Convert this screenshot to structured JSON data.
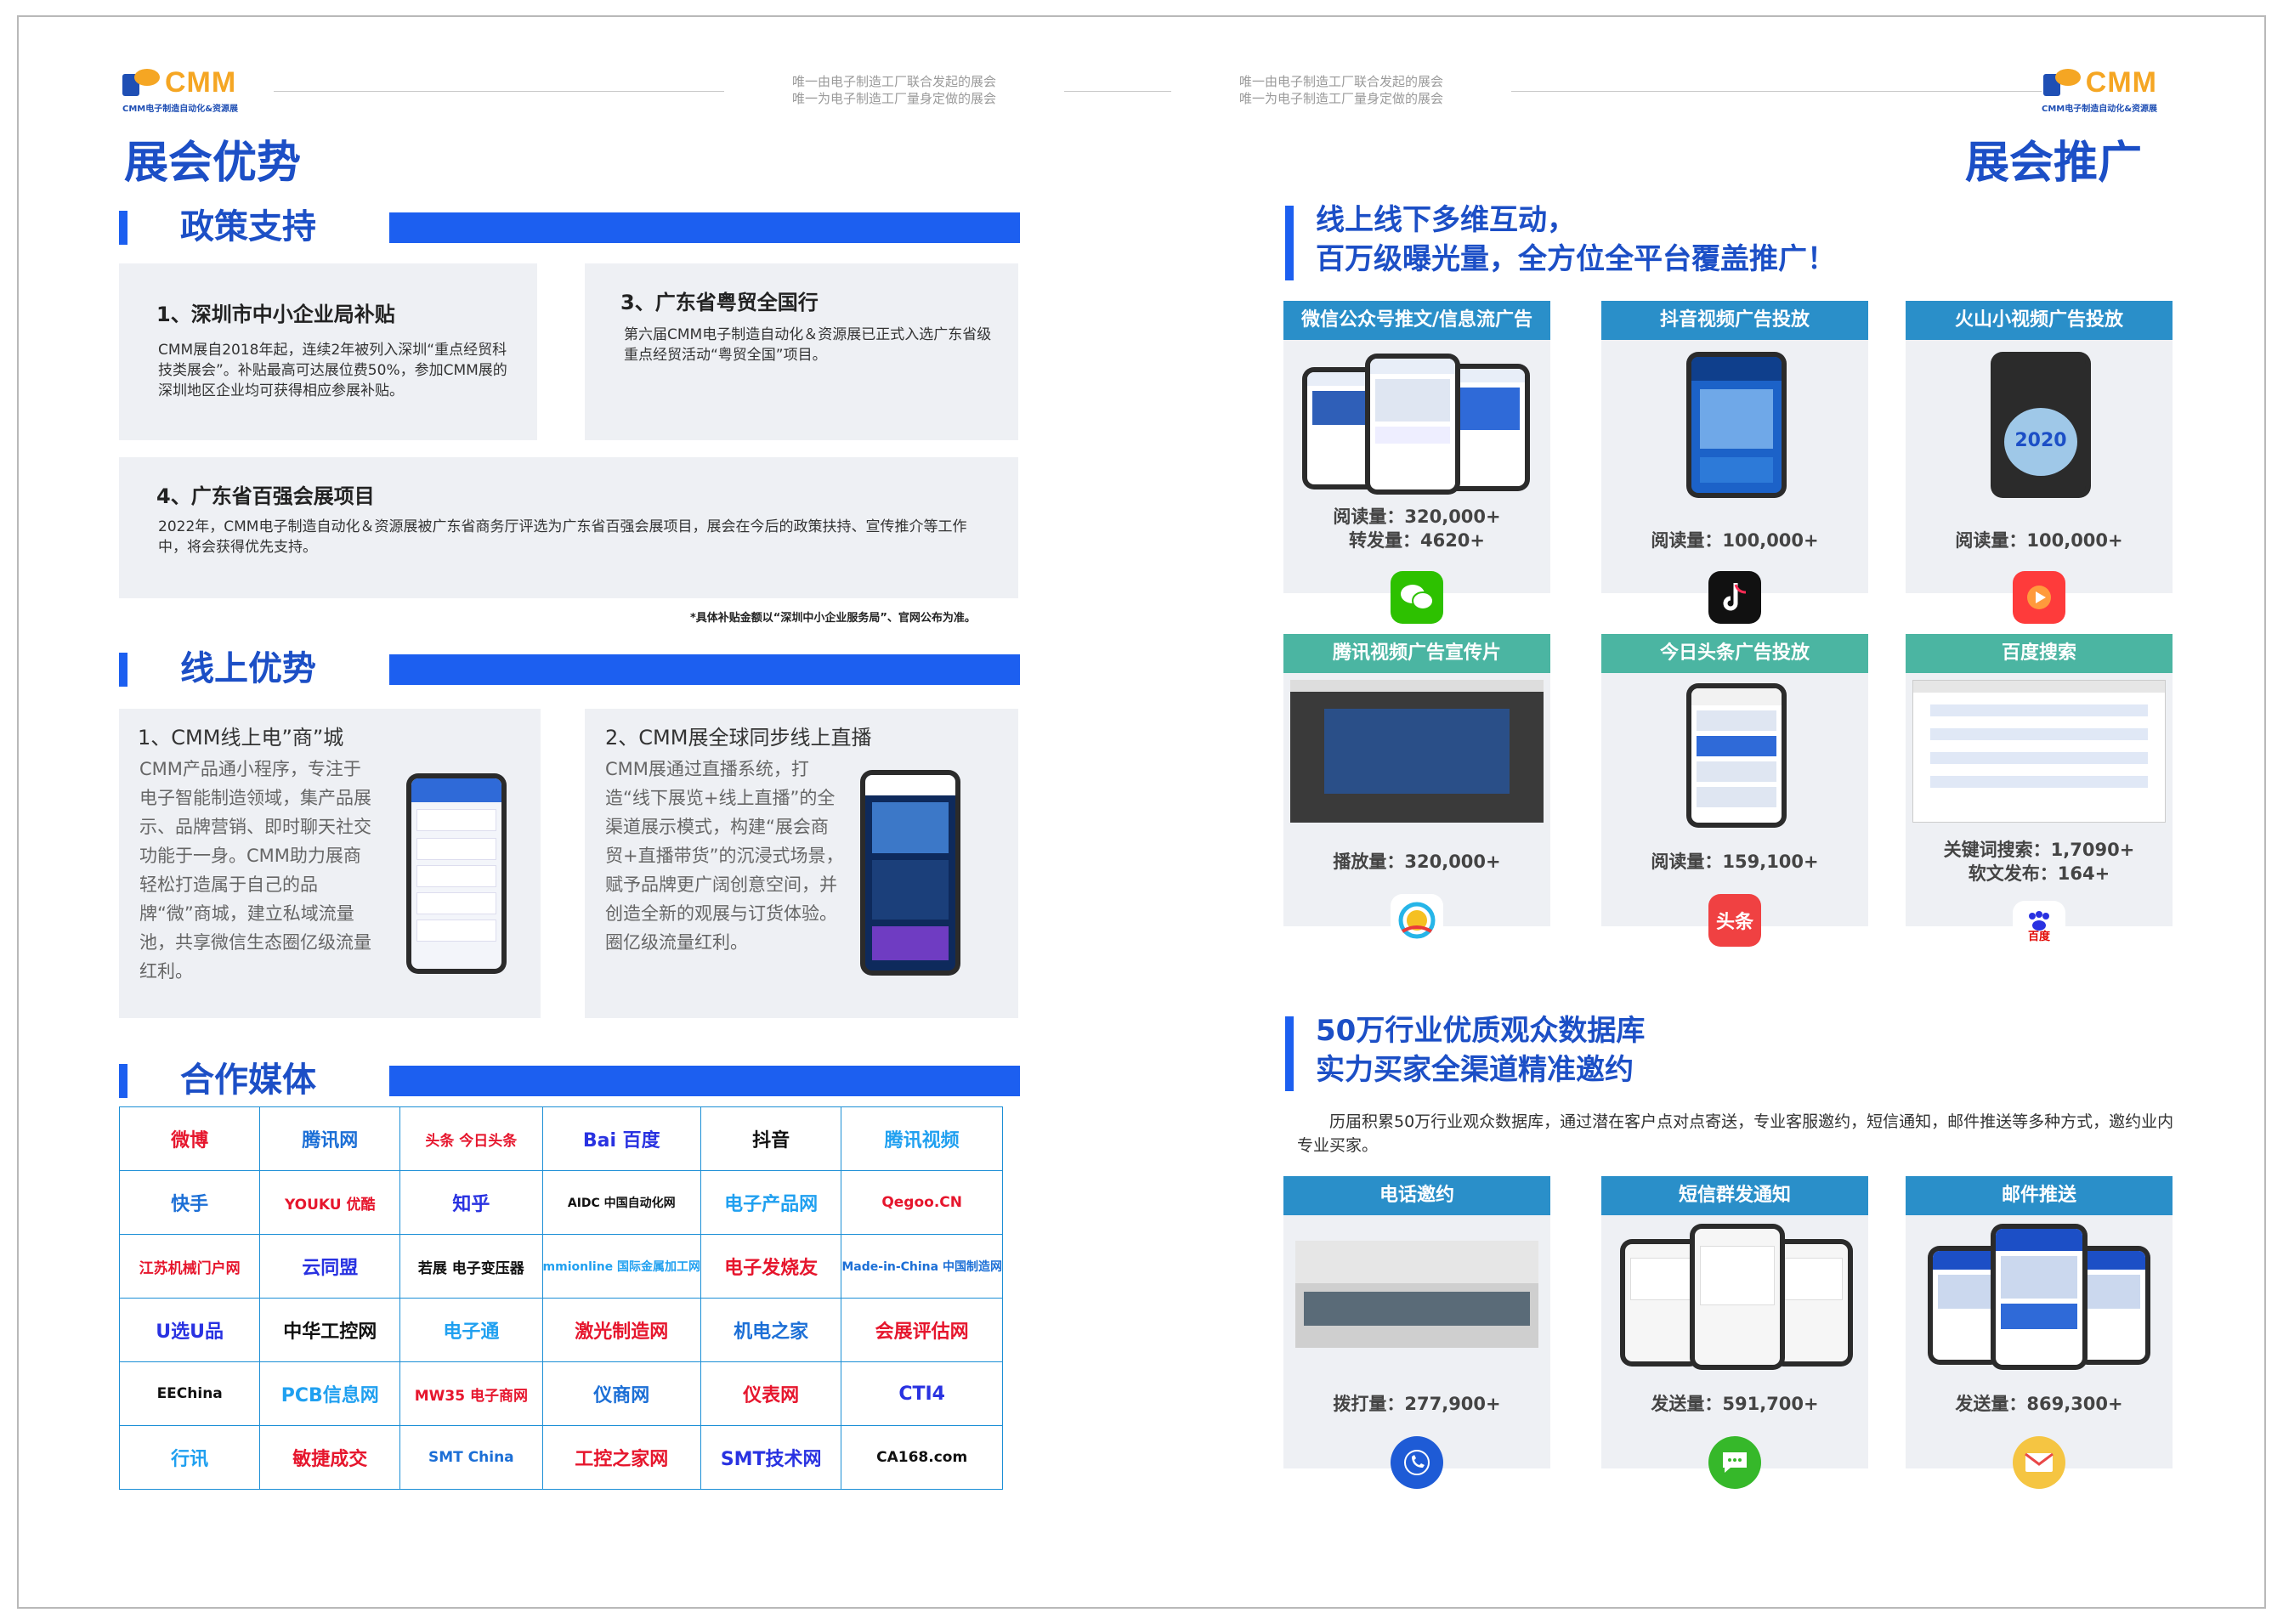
{
  "header": {
    "logo_text": "CMM",
    "logo_sub": "CMM电子制造自动化&资源展",
    "slogan_line1": "唯一由电子制造工厂联合发起的展会",
    "slogan_line2": "唯一为电子制造工厂量身定做的展会"
  },
  "left": {
    "title": "展会优势",
    "policy": {
      "heading": "政策支持",
      "card1_title": "1、深圳市中小企业局补贴",
      "card1_body": "CMM展自2018年起，连续2年被列入深圳“重点经贸科技类展会”。补贴最高可达展位费50%，参加CMM展的深圳地区企业均可获得相应参展补贴。",
      "card3_title": "3、广东省粤贸全国行",
      "card3_body": "第六届CMM电子制造自动化＆资源展已正式入选广东省级重点经贸活动“粤贸全国”项目。",
      "card4_title": "4、广东省百强会展项目",
      "card4_body": "2022年，CMM电子制造自动化＆资源展被广东省商务厅评选为广东省百强会展项目，展会在今后的政策扶持、宣传推介等工作中，将会获得优先支持。",
      "note": "*具体补贴金额以“深圳中小企业服务局”、官网公布为准。"
    },
    "online": {
      "heading": "线上优势",
      "item1_title": "1、CMM线上电”商”城",
      "item1_body": "CMM产品通小程序，专注于电子智能制造领域，集产品展示、品牌营销、即时聊天社交功能于一身。CMM助力展商轻松打造属于自己的品牌“微”商城，建立私域流量池，共享微信生态圈亿级流量红利。",
      "item2_title": "2、CMM展全球同步线上直播",
      "item2_body": "CMM展通过直播系统，打造“线下展览+线上直播”的全渠道展示模式，构建“展会商贸+直播带货”的沉浸式场景，赋予品牌更广阔创意空间，并创造全新的观展与订货体验。圈亿级流量红利。"
    },
    "media": {
      "heading": "合作媒体",
      "rows": [
        [
          "微博",
          "腾讯网",
          "头条 今日头条",
          "Bai 百度",
          "抖音",
          "腾讯视频"
        ],
        [
          "快手",
          "YOUKU 优酷",
          "知乎",
          "AIDC 中国自动化网",
          "电子产品网",
          "Qegoo.CN"
        ],
        [
          "江苏机械门户网",
          "云同盟",
          "若展 电子变压器",
          "mmionline 国际金属加工网",
          "电子发烧友",
          "Made-in-China 中国制造网"
        ],
        [
          "U选U品",
          "中华工控网",
          "电子通",
          "激光制造网",
          "机电之家",
          "会展评估网"
        ],
        [
          "EEChina",
          "PCB信息网",
          "MW35 电子商网",
          "仪商网",
          "仪表网",
          "CTI4"
        ],
        [
          "行讯",
          "敏捷成交",
          "SMT China",
          "工控之家网",
          "SMT技术网",
          "CA168.com"
        ]
      ]
    }
  },
  "right": {
    "title": "展会推广",
    "promo_heading_line1": "线上线下多维互动，",
    "promo_heading_line2": "百万级曝光量，全方位全平台覆盖推广！",
    "cards": [
      {
        "title": "微信公众号推文/信息流广告",
        "stat1": "阅读量：320,000+",
        "stat2": "转发量：4620+",
        "icon": "wechat-icon"
      },
      {
        "title": "抖音视频广告投放",
        "stat1": "阅读量：100,000+",
        "stat2": "",
        "icon": "tiktok-icon"
      },
      {
        "title": "火山小视频广告投放",
        "stat1": "阅读量：100,000+",
        "stat2": "",
        "icon": "huoshan-icon"
      },
      {
        "title": "腾讯视频广告宣传片",
        "stat1": "播放量：320,000+",
        "stat2": "",
        "icon": "tencent-video-icon"
      },
      {
        "title": "今日头条广告投放",
        "stat1": "阅读量：159,100+",
        "stat2": "",
        "icon": "toutiao-icon"
      },
      {
        "title": "百度搜索",
        "stat1": "关键词搜索：1,7090+",
        "stat2": "软文发布：164+",
        "icon": "baidu-icon"
      }
    ],
    "toutiao_icon_text": "头条",
    "baidu_icon_text": "百度",
    "screen_year": "2020",
    "db_heading_line1": "50万行业优质观众数据库",
    "db_heading_line2": "实力买家全渠道精准邀约",
    "db_desc": "历届积累50万行业观众数据库，通过潜在客户点对点寄送，专业客服邀约，短信通知，邮件推送等多种方式，邀约业内专业买家。",
    "invite_cards": [
      {
        "title": "电话邀约",
        "stat": "拨打量：277,900+",
        "icon": "phone-icon"
      },
      {
        "title": "短信群发通知",
        "stat": "发送量：591,700+",
        "icon": "sms-icon"
      },
      {
        "title": "邮件推送",
        "stat": "发送量：869,300+",
        "icon": "mail-icon"
      }
    ]
  },
  "colors": {
    "brand_blue": "#1c4fc6",
    "accent_orange": "#f5a623",
    "card_header_blue": "#2a8fc9",
    "card_header_green": "#4bb5a2",
    "card_bg": "#eef0f4"
  }
}
